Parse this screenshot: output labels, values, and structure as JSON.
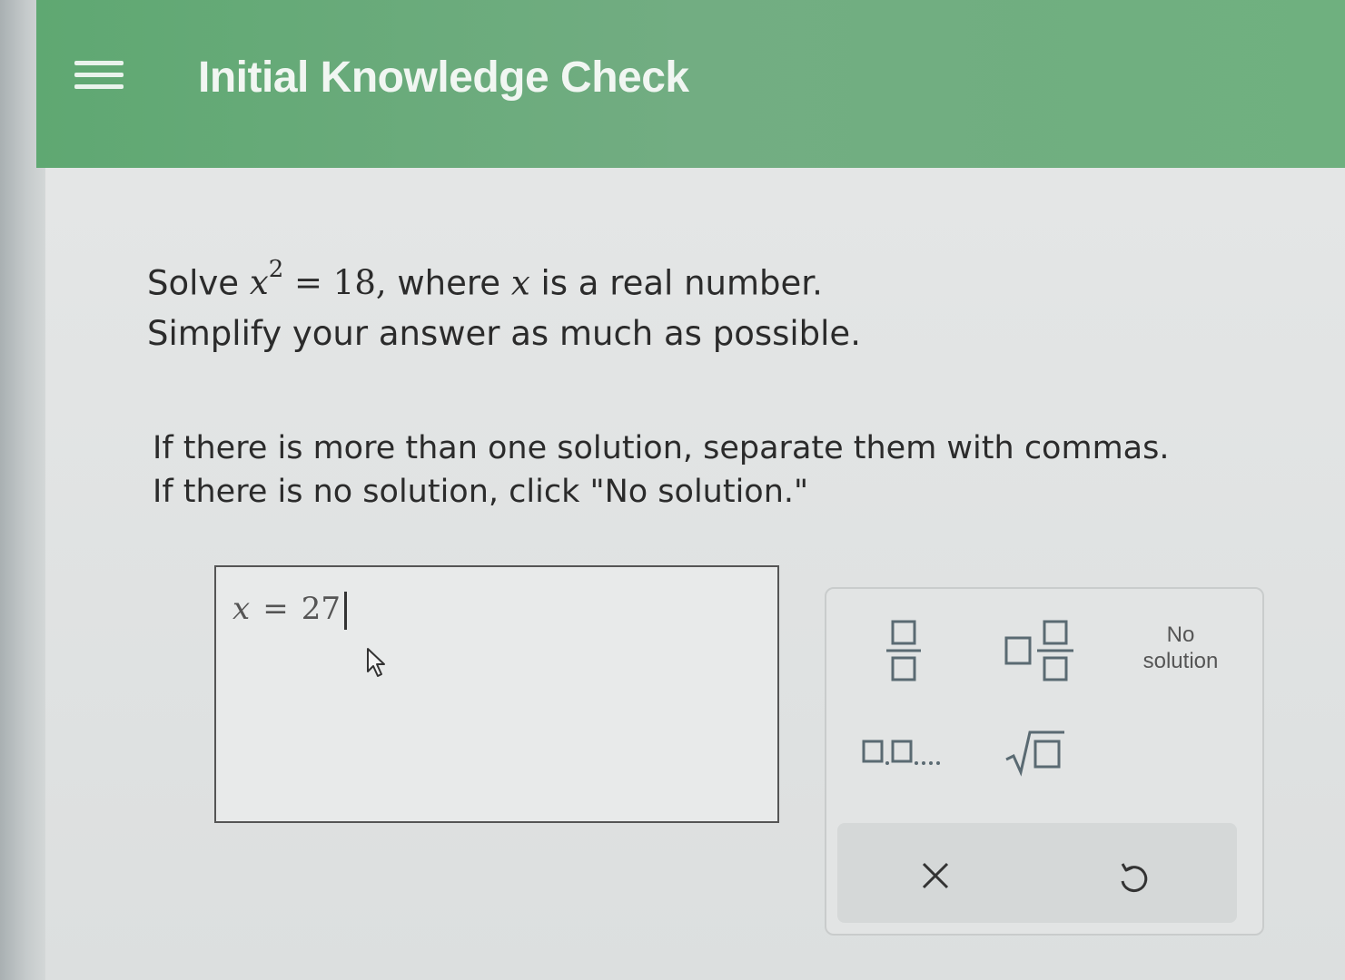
{
  "header": {
    "title": "Initial Knowledge Check"
  },
  "problem": {
    "solve_word": "Solve",
    "equation_var": "x",
    "equation_exp": "2",
    "equation_rest": "= 18,",
    "where_text": "where",
    "var_x": "x",
    "real_text": "is a real number.",
    "line2": "Simplify your answer as much as possible."
  },
  "instructions": {
    "line1": "If there is more than one solution, separate them with commas.",
    "line2": "If there is no solution, click \"No solution.\""
  },
  "answer": {
    "variable": "x",
    "equals": "=",
    "value": "27"
  },
  "keypad": {
    "keys": [
      {
        "name": "fraction-key",
        "icon": "fraction-icon"
      },
      {
        "name": "mixed-number-key",
        "icon": "mixed-number-icon"
      },
      {
        "name": "no-solution-key",
        "label_line1": "No",
        "label_line2": "solution"
      },
      {
        "name": "list-key",
        "icon": "list-icon"
      },
      {
        "name": "square-root-key",
        "icon": "square-root-icon"
      }
    ],
    "clear_icon": "close-icon",
    "undo_icon": "undo-icon"
  },
  "colors": {
    "header_green": "#6aab7b",
    "icon_gray_blue": "#5a6a72"
  }
}
